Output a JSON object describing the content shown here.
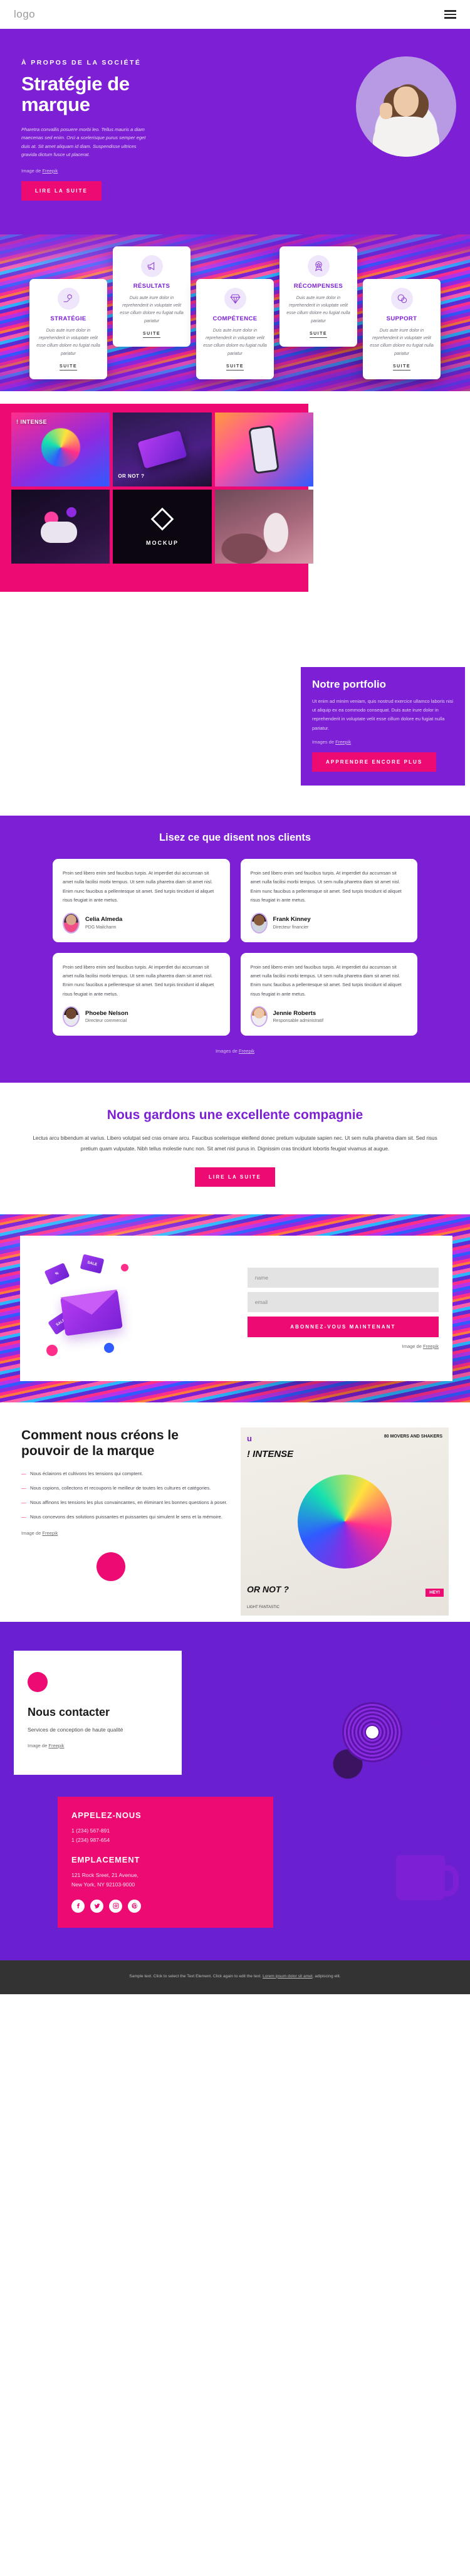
{
  "header": {
    "logo": "logo",
    "menu_icon": "hamburger-menu-icon"
  },
  "hero": {
    "eyebrow": "À PROPOS DE LA SOCIÉTÉ",
    "title": "Stratégie de marque",
    "body": "Pharetra convallis posuere morbi leo. Tellus mauris a diam maecenas sed enim. Orci a scelerisque purus semper eget duis at. Sit amet aliquam id diam. Suspendisse ultrices gravida dictum fusce ut placerat.",
    "credit_prefix": "Image de ",
    "credit_link": "Freepik",
    "cta": "LIRE LA SUITE",
    "bg_color": "#7d1fd4",
    "accent_color": "#ed0a72"
  },
  "features": {
    "suite_label": "SUITE",
    "cards": [
      {
        "icon": "hand-lightbulb-icon",
        "title": "STRATÉGIE",
        "body": "Duis aute irure dolor in reprehenderit in voluptate velit esse cillum dolore eu fugiat nulla pariatur",
        "link": "SUITE"
      },
      {
        "icon": "megaphone-icon",
        "title": "RÉSULTATS",
        "body": "Duis aute irure dolor in reprehenderit in voluptate velit esse cillum dolore eu fugiat nulla pariatur",
        "link": "SUITE"
      },
      {
        "icon": "diamond-icon",
        "title": "COMPÉTENCE",
        "body": "Duis aute irure dolor in reprehenderit in voluptate velit esse cillum dolore eu fugiat nulla pariatur",
        "link": "SUITE"
      },
      {
        "icon": "award-ribbon-icon",
        "title": "RÉCOMPENSES",
        "body": "Duis aute irure dolor in reprehenderit in voluptate velit esse cillum dolore eu fugiat nulla pariatur",
        "link": "SUITE"
      },
      {
        "icon": "chat-bubbles-icon",
        "title": "SUPPORT",
        "body": "Duis aute irure dolor in reprehenderit in voluptate velit esse cillum dolore eu fugiat nulla pariatur",
        "link": "SUITE"
      }
    ]
  },
  "portfolio": {
    "tiles": [
      {
        "label": "! INTENSE",
        "label2": ""
      },
      {
        "label": "",
        "label2": "OR NOT ?"
      },
      {
        "label": "",
        "label2": ""
      },
      {
        "label": "",
        "label2": ""
      },
      {
        "label": "MOCKUP",
        "label2": ""
      },
      {
        "label": "",
        "label2": ""
      }
    ],
    "title": "Notre portfolio",
    "body": "Ut enim ad minim veniam, quis nostrud exercice ullamco laboris nisi ut aliquip ex ea commodo consequat. Duis aute irure dolor in reprehenderit in voluptate velit esse cillum dolore eu fugiat nulla pariatur.",
    "credit_prefix": "Images de ",
    "credit_link": "Freepik",
    "cta": "APPRENDRE ENCORE PLUS"
  },
  "testimonials": {
    "title": "Lisez ce que disent nos clients",
    "quote": "Proin sed libero enim sed faucibus turpis. At imperdiet dui accumsan sit amet nulla facilisi morbi tempus. Ut sem nulla pharetra diam sit amet nisl. Enim nunc faucibus a pellentesque sit amet. Sed turpis tincidunt id aliquet risus feugiat in ante metus.",
    "credit_prefix": "Images de ",
    "credit_link": "Freepik",
    "people": [
      {
        "name": "Celia Almeda",
        "role": "PDG Mailcharm"
      },
      {
        "name": "Frank Kinney",
        "role": "Directeur financier"
      },
      {
        "name": "Phoebe Nelson",
        "role": "Directeur commercial"
      },
      {
        "name": "Jennie Roberts",
        "role": "Responsable administratif"
      }
    ]
  },
  "excellent": {
    "title": "Nous gardons une excellente compagnie",
    "body": "Lectus arcu bibendum at varius. Libero volutpat sed cras ornare arcu. Faucibus scelerisque eleifend donec pretium vulputate sapien nec. Ut sem nulla pharetra diam sit. Sed risus pretium quam vulputate. Nibh tellus molestie nunc non. Sit amet nisl purus in. Dignissim cras tincidunt lobortis feugiat vivamus at augue.",
    "cta": "LIRE LA SUITE"
  },
  "subscribe": {
    "name_placeholder": "name",
    "email_placeholder": "email",
    "cta": "ABONNEZ-VOUS MAINTENANT",
    "credit_prefix": "Image de ",
    "credit_link": "Freepik",
    "art_labels": [
      "SALE",
      "SALE",
      "%"
    ]
  },
  "brandpower": {
    "title": "Comment nous créons le pouvoir de la marque",
    "bullets": [
      "Nous éclairons et cultivons les tensions qui comptent.",
      "Nous copions, collectons et recoupons le meilleur de toutes les cultures et catégories.",
      "Nous affinons les tensions les plus convaincantes, en éliminant les bonnes questions à poser.",
      "Nous concevons des solutions puissantes et puissantes qui simulent le sens et la mémoire."
    ],
    "credit_prefix": "Image de ",
    "credit_link": "Freepik",
    "magazine": {
      "brand": "u",
      "badge": "80 MOVERS\nAND SHAKERS",
      "title": "! INTENSE",
      "bottom": "OR NOT ?",
      "foot": "LIGHT FANTASTIC",
      "pink_tag": "HEY!"
    }
  },
  "contact": {
    "title": "Nous contacter",
    "subtitle": "Services de conception de haute qualité",
    "credit_prefix": "Image de ",
    "credit_link": "Freepik",
    "call_title": "APPELEZ-NOUS",
    "phones": [
      "1 (234) 567-891",
      "1 (234) 987-654"
    ],
    "location_title": "EMPLACEMENT",
    "address": [
      "121 Rock Sreet, 21 Avenue,",
      "New York, NY 92103-9000"
    ],
    "socials": [
      "facebook-icon",
      "twitter-icon",
      "instagram-icon",
      "pinterest-icon"
    ]
  },
  "footer": {
    "text_prefix": "Sample text. Click to select the Text Element. Click again to edit the text. ",
    "link": "Lorem ipsum dolor sit amet",
    "text_suffix": ", adipiscing elit."
  }
}
